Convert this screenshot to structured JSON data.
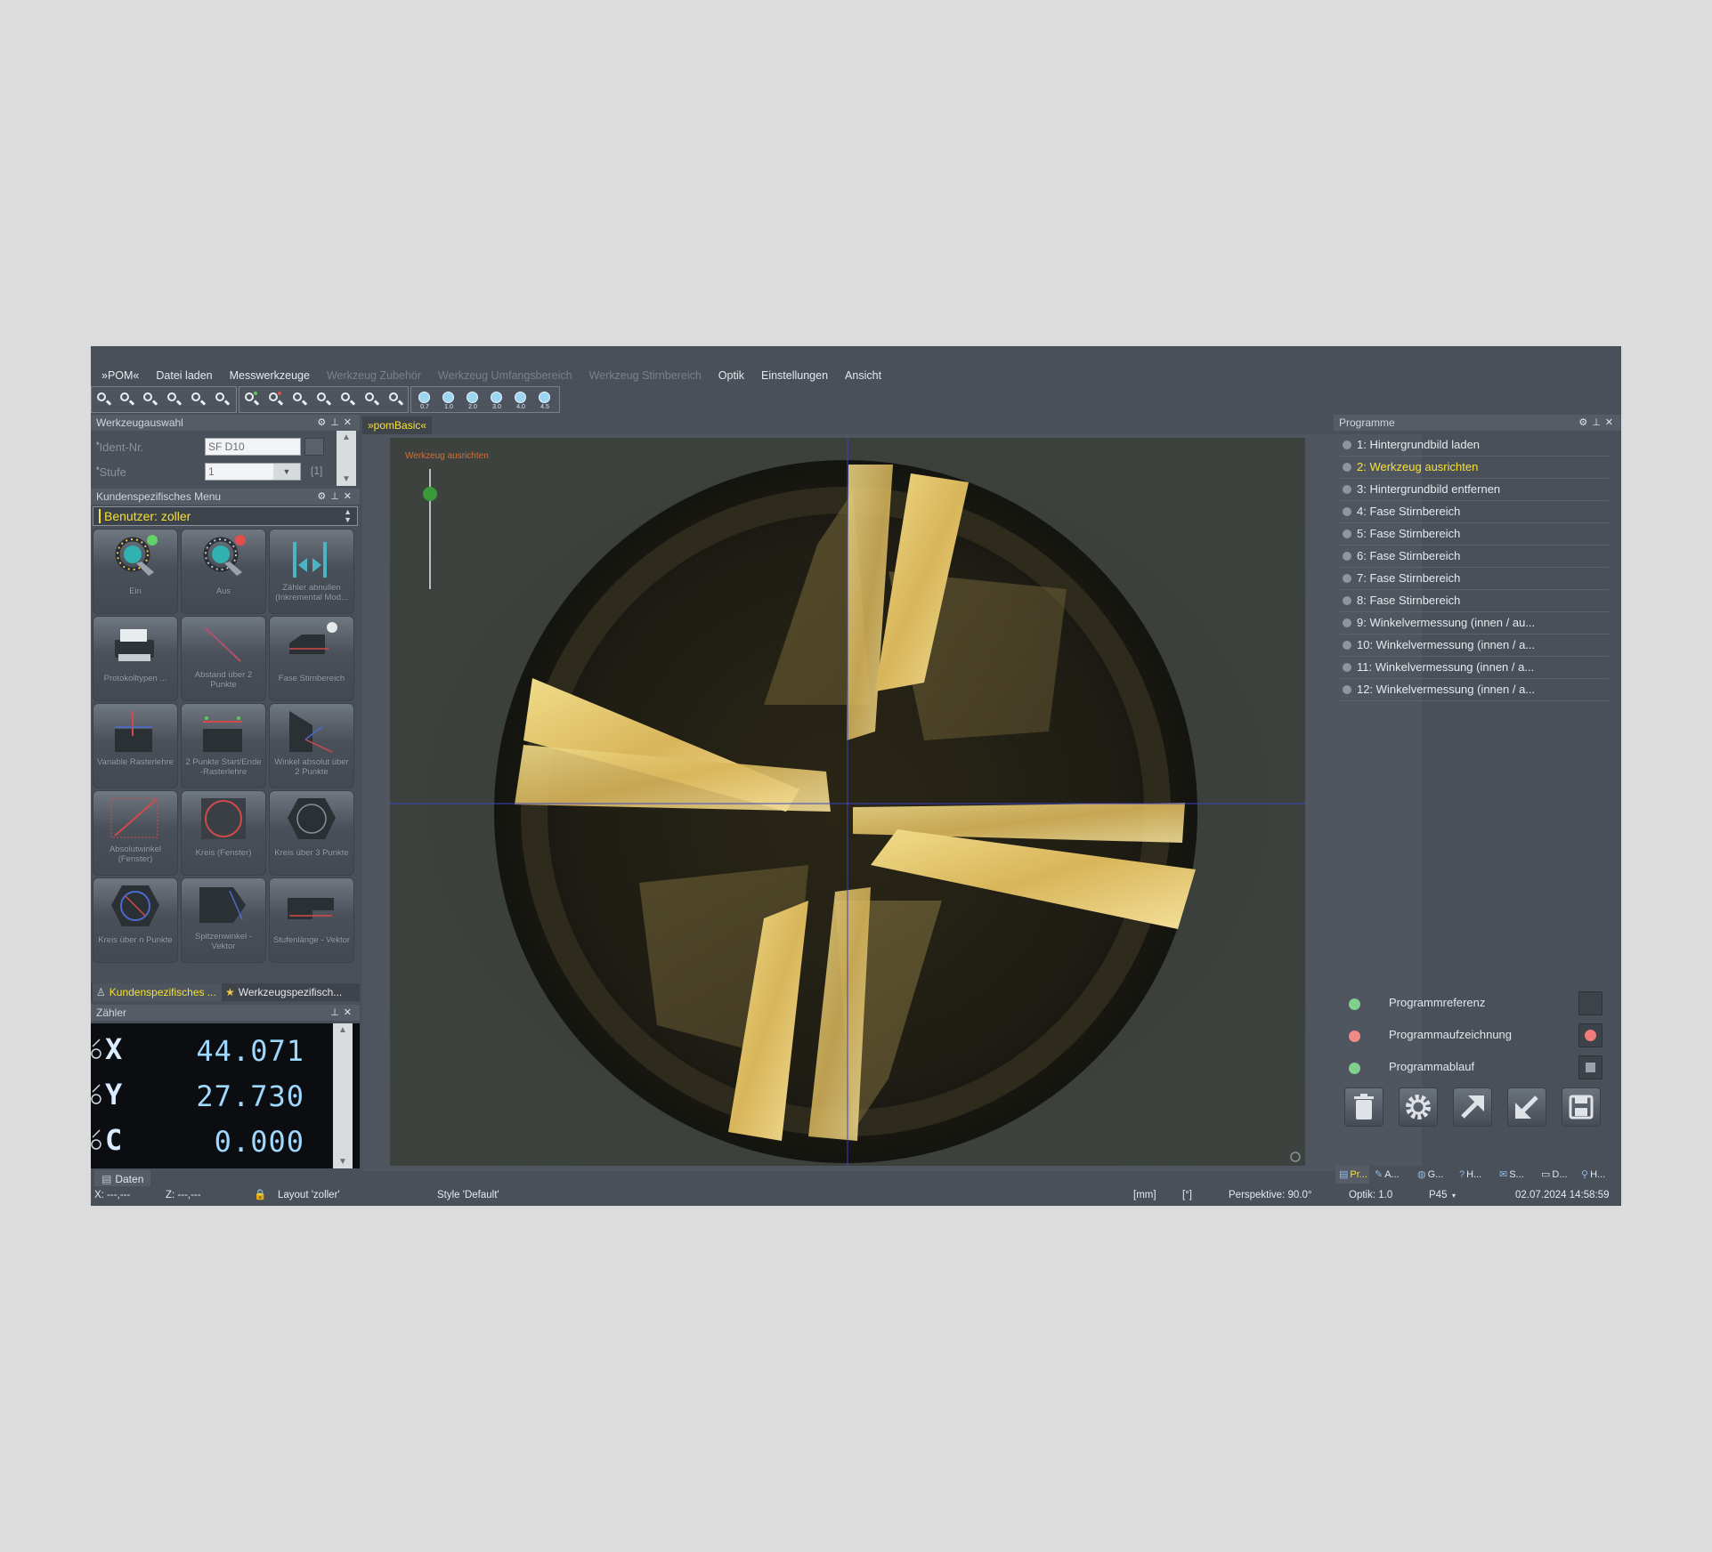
{
  "menu": {
    "items": [
      {
        "label": "»POM«",
        "enabled": true
      },
      {
        "label": "Datei laden",
        "enabled": true
      },
      {
        "label": "Messwerkzeuge",
        "enabled": true
      },
      {
        "label": "Werkzeug Zubehör",
        "enabled": false
      },
      {
        "label": "Werkzeug Umfangsbereich",
        "enabled": false
      },
      {
        "label": "Werkzeug Stirnbereich",
        "enabled": false
      },
      {
        "label": "Optik",
        "enabled": true
      },
      {
        "label": "Einstellungen",
        "enabled": true
      },
      {
        "label": "Ansicht",
        "enabled": true
      }
    ]
  },
  "toolbar": {
    "zoom_group": [
      "zoom-in-icon",
      "zoom-out-icon",
      "zoom-fit-icon",
      "zoom-100-icon",
      "zoom-window-icon",
      "zoom-plus-icon"
    ],
    "measure_group": [
      "measure-point-icon",
      "measure-line-icon",
      "measure-angle-icon",
      "measure-minus-icon",
      "measure-curve-icon",
      "measure-light-icon",
      "measure-dollar-icon"
    ],
    "magnification_labels": [
      "0.7",
      "1.0",
      "2.0",
      "3.0",
      "4.0",
      "4.5"
    ]
  },
  "werkzeugauswahl": {
    "title": "Werkzeugauswahl",
    "ident_label": "Ident-Nr.",
    "ident_value": "SF D10",
    "stufe_label": "Stufe",
    "stufe_value": "1",
    "stufe_count": "[1]"
  },
  "kundenmenu": {
    "title": "Kundenspezifisches Menu",
    "user": "Benutzer: zoller",
    "tiles": [
      {
        "label": "Ein",
        "icon": "light-ring-on-icon"
      },
      {
        "label": "Aus",
        "icon": "light-ring-off-icon"
      },
      {
        "label": "Zähler abnullen (Inkremental Mod...",
        "icon": "counter-zero-icon"
      },
      {
        "label": "Protokolltypen ...",
        "icon": "printer-icon"
      },
      {
        "label": "Abstand über 2 Punkte",
        "icon": "distance-two-points-icon"
      },
      {
        "label": "Fase Stirnbereich",
        "icon": "chamfer-front-icon"
      },
      {
        "label": "Variable Rasterlehre",
        "icon": "variable-grid-gauge-icon"
      },
      {
        "label": "2 Punkte Start/Ende -Rasterlehre",
        "icon": "two-point-grid-gauge-icon"
      },
      {
        "label": "Winkel absolut über 2 Punkte",
        "icon": "angle-two-points-icon"
      },
      {
        "label": "Absolutwinkel (Fenster)",
        "icon": "absolute-angle-window-icon"
      },
      {
        "label": "Kreis (Fenster)",
        "icon": "circle-window-icon"
      },
      {
        "label": "Kreis über 3 Punkte",
        "icon": "circle-three-points-icon"
      },
      {
        "label": "Kreis über n Punkte",
        "icon": "circle-n-points-icon"
      },
      {
        "label": "Spitzenwinkel - Vektor",
        "icon": "tip-angle-vector-icon"
      },
      {
        "label": "Stufenlänge - Vektor",
        "icon": "step-length-vector-icon"
      }
    ],
    "tabs": [
      {
        "label": "Kundenspezifisches ...",
        "active": true
      },
      {
        "label": "Werkzeugspezifisch...",
        "active": false
      }
    ]
  },
  "zaehler": {
    "title": "Zähler",
    "rows": [
      {
        "axis": "X",
        "value": "44.071"
      },
      {
        "axis": "Y",
        "value": "27.730"
      },
      {
        "axis": "C",
        "value": "0.000"
      }
    ],
    "bottom_tab": "Daten"
  },
  "viewer": {
    "tab": "»pomBasic«",
    "overlay_label": "Werkzeug ausrichten"
  },
  "programme": {
    "title": "Programme",
    "items": [
      {
        "label": "1: Hintergrundbild laden",
        "active": false
      },
      {
        "label": "2: Werkzeug ausrichten",
        "active": true
      },
      {
        "label": "3: Hintergrundbild entfernen",
        "active": false
      },
      {
        "label": "4: Fase Stirnbereich",
        "active": false
      },
      {
        "label": "5: Fase Stirnbereich",
        "active": false
      },
      {
        "label": "6: Fase Stirnbereich",
        "active": false
      },
      {
        "label": "7: Fase Stirnbereich",
        "active": false
      },
      {
        "label": "8: Fase Stirnbereich",
        "active": false
      },
      {
        "label": "9: Winkelvermessung (innen / au...",
        "active": false
      },
      {
        "label": "10: Winkelvermessung (innen / a...",
        "active": false
      },
      {
        "label": "11: Winkelvermessung (innen / a...",
        "active": false
      },
      {
        "label": "12: Winkelvermessung (innen / a...",
        "active": false
      }
    ],
    "status": [
      {
        "label": "Programmreferenz",
        "color": "#7fd08a"
      },
      {
        "label": "Programmaufzeichnung",
        "color": "#f08a86"
      },
      {
        "label": "Programmablauf",
        "color": "#7fd08a"
      }
    ],
    "actions": [
      "trash-icon",
      "gear-icon",
      "export-arrow-icon",
      "import-arrow-icon",
      "save-icon"
    ],
    "bottom_tabs": [
      "Pr...",
      "A...",
      "G...",
      "H...",
      "S...",
      "D...",
      "H..."
    ]
  },
  "statusbar": {
    "x": "X: ---,---",
    "z": "Z: ---,---",
    "layout": "Layout 'zoller'",
    "style": "Style 'Default'",
    "unit_mm": "[mm]",
    "unit_deg": "[°]",
    "perspektive": "Perspektive: 90.0°",
    "optik": "Optik: 1.0",
    "p45": "P45",
    "datetime": "02.07.2024 14:58:59"
  },
  "colors": {
    "app_bg": "#4a5059",
    "highlight_yellow": "#f6e033",
    "counter_digits": "#9ed8ff",
    "overlay_text": "#d4703a",
    "marker_green": "#3a9a3a"
  }
}
